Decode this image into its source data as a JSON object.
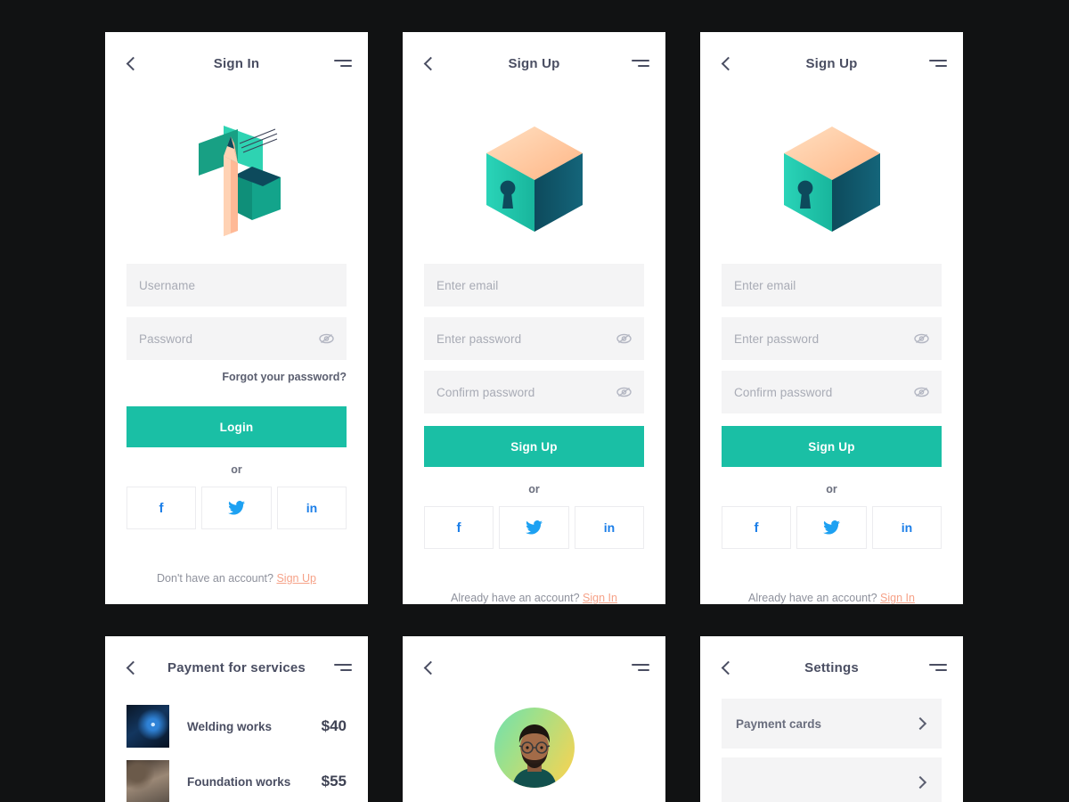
{
  "theme": {
    "background": "#111213",
    "card_background": "#ffffff",
    "accent_teal": "#1abfa5",
    "field_background": "#f4f4f5",
    "text_dark": "#4a4e62",
    "placeholder": "#a8abb5",
    "link_peach": "#f6a288",
    "social_blue": "#1b7ee8",
    "twitter_blue": "#1da1f2",
    "illustration_peach": "#ffc79b",
    "illustration_teal": "#22c7ae",
    "illustration_dark_teal": "#0d4a5c"
  },
  "screens": {
    "signin": {
      "title": "Sign In",
      "back_icon": "chevron-left-icon",
      "menu_icon": "menu-icon",
      "illustration": "pencil-papers-box-illustration",
      "fields": [
        {
          "name": "username",
          "placeholder": "Username",
          "has_eye": false
        },
        {
          "name": "password",
          "placeholder": "Password",
          "has_eye": true
        }
      ],
      "forgot_label": "Forgot your password?",
      "submit_label": "Login",
      "or_label": "or",
      "socials": [
        {
          "name": "facebook",
          "glyph": "f"
        },
        {
          "name": "twitter",
          "glyph": "bird"
        },
        {
          "name": "linkedin",
          "glyph": "in"
        }
      ],
      "footnote_text": "Don't have an account?",
      "footnote_link": "Sign Up"
    },
    "signup_a": {
      "title": "Sign Up",
      "back_icon": "chevron-left-icon",
      "menu_icon": "menu-icon",
      "illustration": "lock-cube-illustration",
      "fields": [
        {
          "name": "email",
          "placeholder": "Enter email",
          "has_eye": false
        },
        {
          "name": "password",
          "placeholder": "Enter password",
          "has_eye": true
        },
        {
          "name": "confirm-password",
          "placeholder": "Confirm password",
          "has_eye": true
        }
      ],
      "submit_label": "Sign Up",
      "or_label": "or",
      "socials": [
        {
          "name": "facebook",
          "glyph": "f"
        },
        {
          "name": "twitter",
          "glyph": "bird"
        },
        {
          "name": "linkedin",
          "glyph": "in"
        }
      ],
      "footnote_text": "Already have an account?",
      "footnote_link": "Sign In"
    },
    "signup_b": {
      "title": "Sign Up",
      "back_icon": "chevron-left-icon",
      "menu_icon": "menu-icon",
      "illustration": "lock-cube-illustration",
      "fields": [
        {
          "name": "email",
          "placeholder": "Enter email",
          "has_eye": false
        },
        {
          "name": "password",
          "placeholder": "Enter password",
          "has_eye": true
        },
        {
          "name": "confirm-password",
          "placeholder": "Confirm password",
          "has_eye": true
        }
      ],
      "submit_label": "Sign Up",
      "or_label": "or",
      "socials": [
        {
          "name": "facebook",
          "glyph": "f"
        },
        {
          "name": "twitter",
          "glyph": "bird"
        },
        {
          "name": "linkedin",
          "glyph": "in"
        }
      ],
      "footnote_text": "Already have an account?",
      "footnote_link": "Sign In"
    },
    "payments": {
      "title": "Payment for services",
      "back_icon": "chevron-left-icon",
      "menu_icon": "menu-icon",
      "items": [
        {
          "name": "Welding works",
          "price": "$40",
          "thumb": "welding-photo"
        },
        {
          "name": "Foundation works",
          "price": "$55",
          "thumb": "foundation-photo"
        }
      ]
    },
    "profile": {
      "title": "",
      "back_icon": "chevron-left-icon",
      "menu_icon": "menu-icon",
      "avatar": "user-avatar-photo"
    },
    "settings": {
      "title": "Settings",
      "back_icon": "chevron-left-icon",
      "menu_icon": "menu-icon",
      "rows": [
        {
          "label": "Payment cards",
          "chevron": "chevron-right-icon"
        },
        {
          "label": "",
          "chevron": "chevron-right-icon"
        }
      ]
    }
  }
}
